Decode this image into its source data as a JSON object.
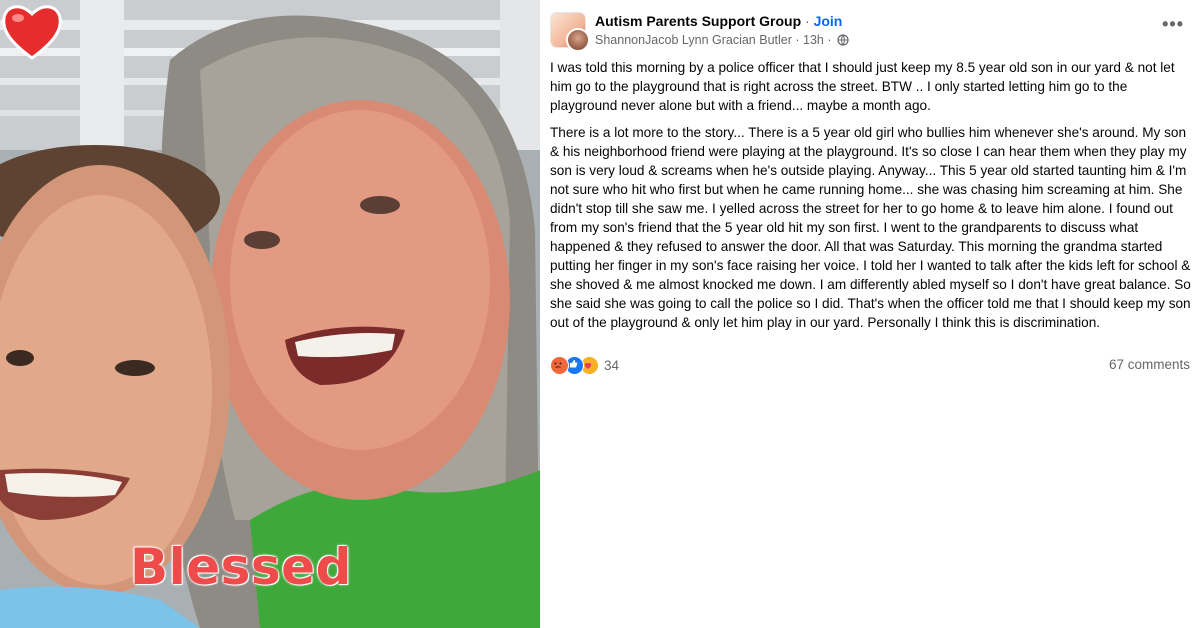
{
  "photo": {
    "overlay_text": "Blessed",
    "overlay_color": "#ef4b4b",
    "sticker_icon": "red-heart"
  },
  "post": {
    "group_name": "Autism Parents Support Group",
    "separator": " · ",
    "join_label": "Join",
    "author": "ShannonJacob Lynn Gracian Butler",
    "time": "13h",
    "audience_icon": "globe-icon",
    "more_label": "•••",
    "paragraphs": [
      "I was told this morning by a police officer that I should just keep my 8.5 year old son in our yard & not let him go to the playground that is right across the street. BTW .. I only started letting him go to the playground never alone but with a friend... maybe a month ago.",
      "There is a lot more to the story... There is a 5 year old girl who bullies him whenever she's around. My son & his neighborhood friend were playing at the playground. It's so close I can hear them when they play my son is very loud & screams when he's outside playing. Anyway... This 5 year old started taunting him & I'm not sure who hit who first but when he came running home... she was chasing him screaming at him. She didn't stop till she saw me. I yelled across the street for her to go home & to leave him alone. I found out from my son's friend that the 5 year old hit my son first. I went to the grandparents to discuss what happened & they refused to answer the door. All that was Saturday. This morning the grandma started putting her finger in my son's face raising her voice. I told her I wanted to talk after the kids left for school & she shoved & me almost knocked me down. I am differently abled myself so I don't have great balance. So she said she was going to call the police so I did. That's when the officer told me that I should keep my son out of the playground & only let him play in our yard. Personally I think this is discrimination."
    ],
    "reactions": {
      "icons": [
        "angry",
        "like",
        "care"
      ],
      "count": "34"
    },
    "comments_label": "67 comments",
    "colors": {
      "accent": "#0866ff",
      "text": "#050505",
      "muted": "#65676b"
    }
  }
}
